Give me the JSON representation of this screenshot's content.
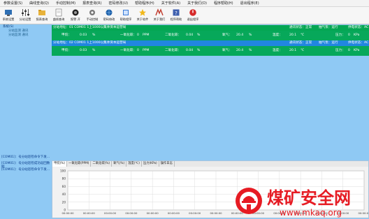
{
  "menu": [
    "参数设置(S)",
    "曲线查询(Q)",
    "手动控制(M)",
    "报表查询(R)",
    "密码修改(U)",
    "帮助程序(H)",
    "关于软件(A)",
    "关于我们(O)",
    "程序帮助(H)",
    "退出程序(E)"
  ],
  "toolbar": [
    {
      "label": "系统设置",
      "icon": "monitor-icon"
    },
    {
      "label": "分站设置",
      "icon": "sliders-icon"
    },
    {
      "label": "报表查询",
      "icon": "folder-icon"
    },
    {
      "label": "曲线查询",
      "icon": "document-icon"
    },
    {
      "label": "报警 开",
      "icon": "alarm-icon"
    },
    {
      "label": "手动控制",
      "icon": "gear-icon"
    },
    {
      "label": "密码修改",
      "icon": "globe-icon"
    },
    {
      "label": "帮助程序",
      "icon": "book-icon"
    },
    {
      "label": "关于软件",
      "icon": "star-icon"
    },
    {
      "label": "关于我们",
      "icon": "logo-icon"
    },
    {
      "label": "程序帮助",
      "icon": "help-icon"
    },
    {
      "label": "退出程序",
      "icon": "exit-icon"
    }
  ],
  "tree": [
    "系统(S)",
    "分站监测 通讯",
    "分站监测 通讯"
  ],
  "panels": [
    {
      "head": "分站地址：01   COM01   1上1000以集体资本运营局",
      "comm_label": "通讯状态：正常",
      "pump_label": "抽气泵：运行",
      "power_label": "供电状态：AC",
      "row": {
        "param": "甲烷：",
        "a": "0.03",
        "a_unit": "%",
        "b_label": "一氧化碳：",
        "b": "0",
        "b_unit": "PPM",
        "c_label": "二氧化碳：",
        "c": "0.04",
        "c_unit": "%",
        "d_label": "氧气：",
        "d": "20.4",
        "d_unit": "%",
        "e_label": "温度：",
        "e": "20.1",
        "e_unit": "℃",
        "f_label": "压力：",
        "f": "0",
        "f_unit": "KPa"
      }
    },
    {
      "head": "分站地址：02   COM01   1上1000以集体资本运营局",
      "comm_label": "通讯状态：正常",
      "pump_label": "抽气泵：运行",
      "power_label": "供电状态：AC",
      "row": {
        "param": "甲烷：",
        "a": "0.03",
        "a_unit": "%",
        "b_label": "一氧化碳：",
        "b": "0",
        "b_unit": "PPM",
        "c_label": "二氧化碳：",
        "c": "0.04",
        "c_unit": "%",
        "d_label": "氧气：",
        "d": "20.4",
        "d_unit": "%",
        "e_label": "温度：",
        "e": "20.1",
        "e_unit": "℃",
        "f_label": "压力：",
        "f": "0",
        "f_unit": "KPa"
      }
    }
  ],
  "cmdlog": [
    "[COM01]：号分站巡检命令下发...",
    "[COM01]：号分站巡检成功返回数据",
    "[COM01]：号分站巡检命令下发..."
  ],
  "chart_tabs": [
    "甲烷(%)",
    "一氧化碳(PPM)",
    "二氧化碳(%)",
    "氧气(%)",
    "温度(℃)",
    "压力(KPa)",
    "操作日志"
  ],
  "chart_data": {
    "type": "line",
    "ylim": [
      0,
      100
    ],
    "yticks": [
      "0",
      "20",
      "40",
      "60",
      "80",
      "100"
    ],
    "xticks": [
      "00:00:00",
      "00:00:00",
      "00:00:00",
      "00:00:00",
      "00:00:00",
      "00:00:00",
      "00:00:00",
      "00:00:00",
      "00:00:00",
      "00:00:00",
      "00:00:00",
      "00:00:00",
      "00:00:00",
      "00:00:00",
      "00:00:00"
    ],
    "series": []
  },
  "watermark": {
    "text": "煤矿安全网",
    "url": "www.mkaq.org",
    "color": "#e61b23"
  }
}
